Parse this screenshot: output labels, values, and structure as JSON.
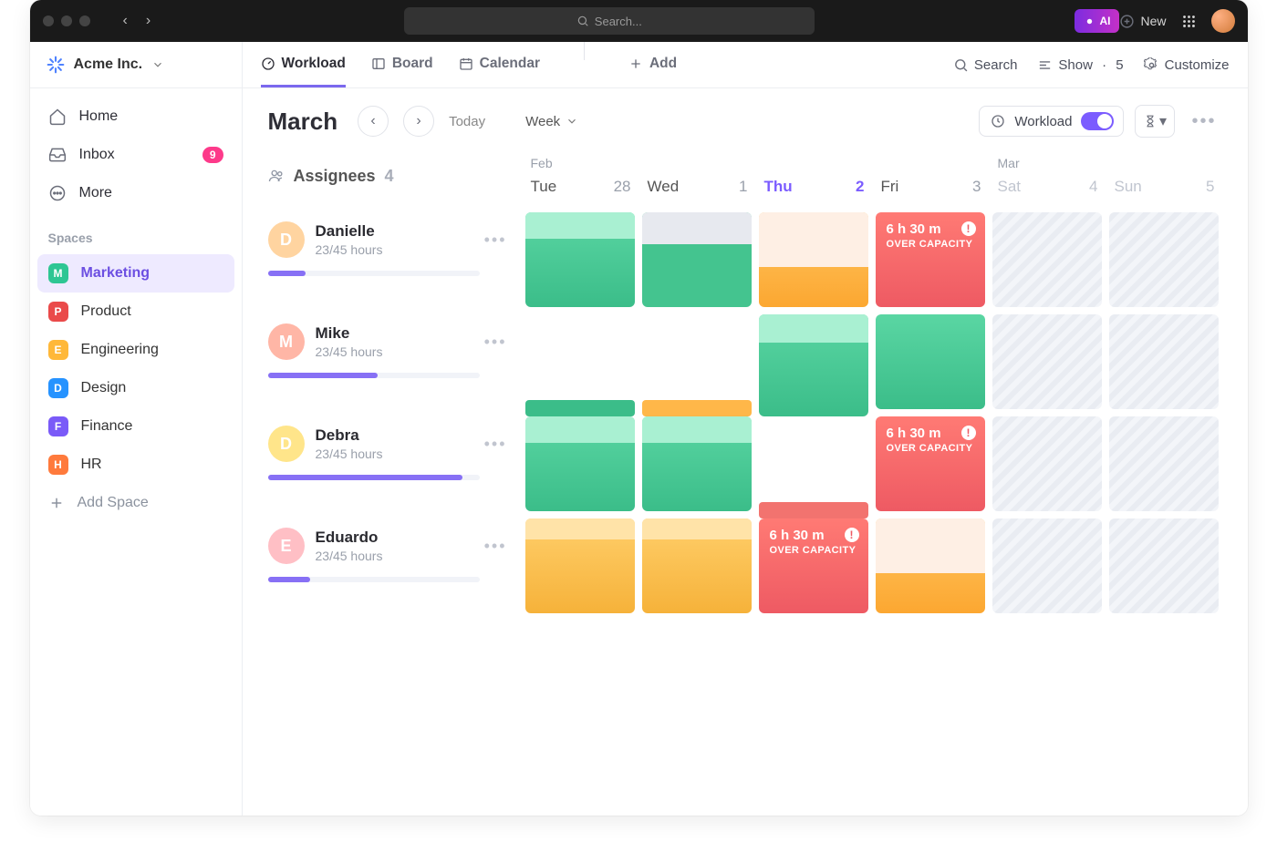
{
  "titlebar": {
    "search_placeholder": "Search...",
    "ai_label": "AI",
    "new_label": "New"
  },
  "workspace": {
    "name": "Acme Inc."
  },
  "sidebar": {
    "home": "Home",
    "inbox": "Inbox",
    "inbox_count": "9",
    "more": "More",
    "spaces_label": "Spaces",
    "spaces": [
      {
        "letter": "M",
        "name": "Marketing",
        "color": "#2ec693",
        "active": true
      },
      {
        "letter": "P",
        "name": "Product",
        "color": "#ea4a4a"
      },
      {
        "letter": "E",
        "name": "Engineering",
        "color": "#ffb839"
      },
      {
        "letter": "D",
        "name": "Design",
        "color": "#2693ff"
      },
      {
        "letter": "F",
        "name": "Finance",
        "color": "#7a5af8"
      },
      {
        "letter": "H",
        "name": "HR",
        "color": "#ff7a3c"
      }
    ],
    "add_space": "Add Space"
  },
  "tabs": {
    "workload": "Workload",
    "board": "Board",
    "calendar": "Calendar",
    "add": "Add"
  },
  "toolbar_right": {
    "search": "Search",
    "show": "Show",
    "show_count": "5",
    "customize": "Customize"
  },
  "subheader": {
    "month": "March",
    "today": "Today",
    "period": "Week",
    "workload_chip": "Workload"
  },
  "columns": {
    "assignees_label": "Assignees",
    "assignees_count": "4",
    "days": [
      {
        "month": "Feb",
        "name": "Tue",
        "num": "28"
      },
      {
        "month": "",
        "name": "Wed",
        "num": "1"
      },
      {
        "month": "",
        "name": "Thu",
        "num": "2",
        "today": true
      },
      {
        "month": "",
        "name": "Fri",
        "num": "3"
      },
      {
        "month": "Mar",
        "name": "Sat",
        "num": "4",
        "weekend": true
      },
      {
        "month": "",
        "name": "Sun",
        "num": "5",
        "weekend": true
      }
    ]
  },
  "over_capacity": {
    "time": "6 h 30 m",
    "label": "OVER CAPACITY"
  },
  "people": [
    {
      "name": "Danielle",
      "hours": "23/45 hours",
      "progress": 18,
      "avatar_bg": "#ffd4a0",
      "cells": [
        "green-cap",
        "gray-green",
        "orange-cap",
        "over",
        "weekend",
        "weekend"
      ]
    },
    {
      "name": "Mike",
      "hours": "23/45 hours",
      "progress": 52,
      "avatar_bg": "#ffb6a6",
      "cells": [
        "slim-green",
        "slim-orange",
        "green-cap-full",
        "green-full",
        "weekend",
        "weekend"
      ]
    },
    {
      "name": "Debra",
      "hours": "23/45 hours",
      "progress": 92,
      "avatar_bg": "#ffe58a",
      "cells": [
        "green-cap",
        "green-cap",
        "slim-red",
        "over",
        "weekend",
        "weekend"
      ]
    },
    {
      "name": "Eduardo",
      "hours": "23/45 hours",
      "progress": 20,
      "avatar_bg": "#ffbfc5",
      "cells": [
        "yellow-cap",
        "yellow-cap",
        "over",
        "orange-cream",
        "weekend",
        "weekend"
      ]
    }
  ]
}
